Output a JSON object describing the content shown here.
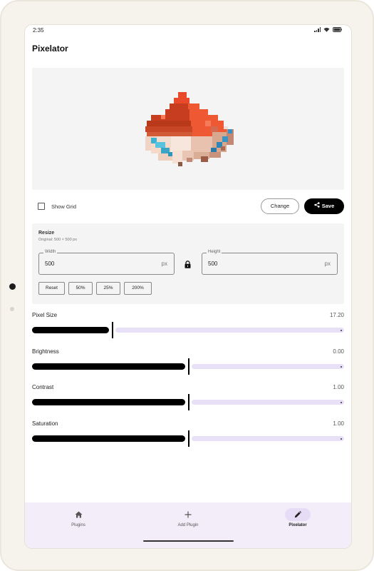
{
  "status_bar": {
    "time": "2:35"
  },
  "app": {
    "title": "Pixelator"
  },
  "preview": {
    "description_icon": "pixel-art-mushroom-image"
  },
  "controls": {
    "show_grid_label": "Show Grid",
    "show_grid_checked": false,
    "change_label": "Change",
    "save_label": "Save"
  },
  "resize": {
    "title": "Resize",
    "original": "Original: 500 × 500 px",
    "width": {
      "label": "Width",
      "value": "500",
      "unit": "px"
    },
    "height": {
      "label": "Height",
      "value": "500",
      "unit": "px"
    },
    "chips": [
      "Reset",
      "50%",
      "25%",
      "200%"
    ]
  },
  "sliders": [
    {
      "label": "Pixel Size",
      "value": "17.20",
      "fraction": 0.255
    },
    {
      "label": "Brightness",
      "value": "0.00",
      "fraction": 0.5
    },
    {
      "label": "Contrast",
      "value": "1.00",
      "fraction": 0.5
    },
    {
      "label": "Saturation",
      "value": "1.00",
      "fraction": 0.5
    }
  ],
  "nav": {
    "items": [
      {
        "label": "Plugins",
        "icon": "home-icon",
        "active": false
      },
      {
        "label": "Add Plugin",
        "icon": "plus-icon",
        "active": false
      },
      {
        "label": "Pixelator",
        "icon": "pencil-icon",
        "active": true
      }
    ]
  },
  "colors": {
    "accent_track": "#e7e0f7",
    "nav_background": "#f2edf8",
    "nav_active_pill": "#e6dcf6",
    "primary": "#000000"
  }
}
